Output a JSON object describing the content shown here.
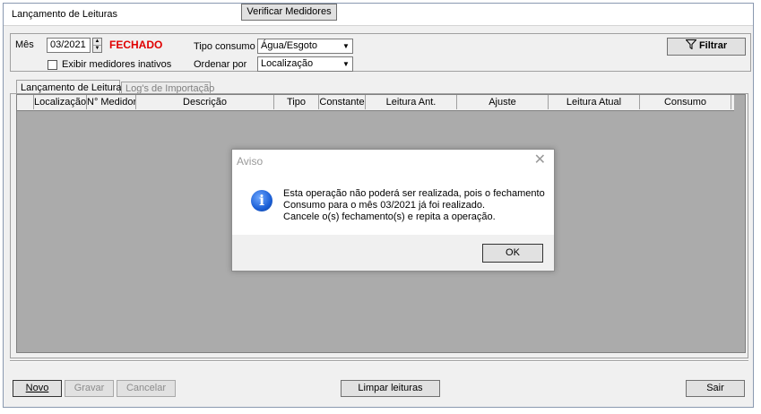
{
  "window": {
    "title": "Lançamento de Leituras"
  },
  "filters": {
    "mes_label": "Mês",
    "mes_value": "03/2021",
    "status_text": "FECHADO",
    "status_color": "#e00000",
    "exibir_label": "Exibir medidores inativos",
    "tipo_consumo_label": "Tipo consumo",
    "tipo_consumo_value": "Água/Esgoto",
    "ordenar_label": "Ordenar por",
    "ordenar_value": "Localização",
    "filtrar_label": "Filtrar"
  },
  "tabs": [
    {
      "label": "Lançamento de Leituras",
      "active": true
    },
    {
      "label": "Log's de Importação",
      "active": false
    }
  ],
  "grid": {
    "columns": [
      "Localização",
      "N° Medidor",
      "Descrição",
      "Tipo",
      "Constante",
      "Leitura Ant.",
      "Ajuste",
      "Leitura Atual",
      "Consumo"
    ]
  },
  "dialog": {
    "title": "Aviso",
    "lines": [
      "Esta operação não poderá ser realizada, pois o fechamento",
      "Consumo para o mês 03/2021 já foi realizado.",
      "Cancele o(s) fechamento(s) e repita a operação."
    ],
    "ok_label": "OK"
  },
  "toolbar": {
    "novo": "Novo",
    "gravar": "Gravar",
    "cancelar": "Cancelar",
    "verificar": "Verificar Medidores",
    "limpar": "Limpar leituras",
    "sair": "Sair"
  }
}
